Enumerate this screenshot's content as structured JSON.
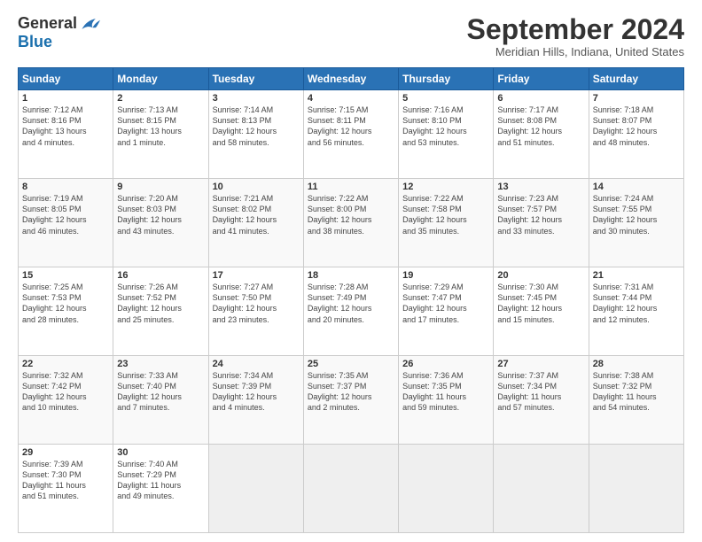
{
  "header": {
    "logo_general": "General",
    "logo_blue": "Blue",
    "title": "September 2024",
    "location": "Meridian Hills, Indiana, United States"
  },
  "days_of_week": [
    "Sunday",
    "Monday",
    "Tuesday",
    "Wednesday",
    "Thursday",
    "Friday",
    "Saturday"
  ],
  "weeks": [
    [
      {
        "day": "1",
        "info": "Sunrise: 7:12 AM\nSunset: 8:16 PM\nDaylight: 13 hours\nand 4 minutes."
      },
      {
        "day": "2",
        "info": "Sunrise: 7:13 AM\nSunset: 8:15 PM\nDaylight: 13 hours\nand 1 minute."
      },
      {
        "day": "3",
        "info": "Sunrise: 7:14 AM\nSunset: 8:13 PM\nDaylight: 12 hours\nand 58 minutes."
      },
      {
        "day": "4",
        "info": "Sunrise: 7:15 AM\nSunset: 8:11 PM\nDaylight: 12 hours\nand 56 minutes."
      },
      {
        "day": "5",
        "info": "Sunrise: 7:16 AM\nSunset: 8:10 PM\nDaylight: 12 hours\nand 53 minutes."
      },
      {
        "day": "6",
        "info": "Sunrise: 7:17 AM\nSunset: 8:08 PM\nDaylight: 12 hours\nand 51 minutes."
      },
      {
        "day": "7",
        "info": "Sunrise: 7:18 AM\nSunset: 8:07 PM\nDaylight: 12 hours\nand 48 minutes."
      }
    ],
    [
      {
        "day": "8",
        "info": "Sunrise: 7:19 AM\nSunset: 8:05 PM\nDaylight: 12 hours\nand 46 minutes."
      },
      {
        "day": "9",
        "info": "Sunrise: 7:20 AM\nSunset: 8:03 PM\nDaylight: 12 hours\nand 43 minutes."
      },
      {
        "day": "10",
        "info": "Sunrise: 7:21 AM\nSunset: 8:02 PM\nDaylight: 12 hours\nand 41 minutes."
      },
      {
        "day": "11",
        "info": "Sunrise: 7:22 AM\nSunset: 8:00 PM\nDaylight: 12 hours\nand 38 minutes."
      },
      {
        "day": "12",
        "info": "Sunrise: 7:22 AM\nSunset: 7:58 PM\nDaylight: 12 hours\nand 35 minutes."
      },
      {
        "day": "13",
        "info": "Sunrise: 7:23 AM\nSunset: 7:57 PM\nDaylight: 12 hours\nand 33 minutes."
      },
      {
        "day": "14",
        "info": "Sunrise: 7:24 AM\nSunset: 7:55 PM\nDaylight: 12 hours\nand 30 minutes."
      }
    ],
    [
      {
        "day": "15",
        "info": "Sunrise: 7:25 AM\nSunset: 7:53 PM\nDaylight: 12 hours\nand 28 minutes."
      },
      {
        "day": "16",
        "info": "Sunrise: 7:26 AM\nSunset: 7:52 PM\nDaylight: 12 hours\nand 25 minutes."
      },
      {
        "day": "17",
        "info": "Sunrise: 7:27 AM\nSunset: 7:50 PM\nDaylight: 12 hours\nand 23 minutes."
      },
      {
        "day": "18",
        "info": "Sunrise: 7:28 AM\nSunset: 7:49 PM\nDaylight: 12 hours\nand 20 minutes."
      },
      {
        "day": "19",
        "info": "Sunrise: 7:29 AM\nSunset: 7:47 PM\nDaylight: 12 hours\nand 17 minutes."
      },
      {
        "day": "20",
        "info": "Sunrise: 7:30 AM\nSunset: 7:45 PM\nDaylight: 12 hours\nand 15 minutes."
      },
      {
        "day": "21",
        "info": "Sunrise: 7:31 AM\nSunset: 7:44 PM\nDaylight: 12 hours\nand 12 minutes."
      }
    ],
    [
      {
        "day": "22",
        "info": "Sunrise: 7:32 AM\nSunset: 7:42 PM\nDaylight: 12 hours\nand 10 minutes."
      },
      {
        "day": "23",
        "info": "Sunrise: 7:33 AM\nSunset: 7:40 PM\nDaylight: 12 hours\nand 7 minutes."
      },
      {
        "day": "24",
        "info": "Sunrise: 7:34 AM\nSunset: 7:39 PM\nDaylight: 12 hours\nand 4 minutes."
      },
      {
        "day": "25",
        "info": "Sunrise: 7:35 AM\nSunset: 7:37 PM\nDaylight: 12 hours\nand 2 minutes."
      },
      {
        "day": "26",
        "info": "Sunrise: 7:36 AM\nSunset: 7:35 PM\nDaylight: 11 hours\nand 59 minutes."
      },
      {
        "day": "27",
        "info": "Sunrise: 7:37 AM\nSunset: 7:34 PM\nDaylight: 11 hours\nand 57 minutes."
      },
      {
        "day": "28",
        "info": "Sunrise: 7:38 AM\nSunset: 7:32 PM\nDaylight: 11 hours\nand 54 minutes."
      }
    ],
    [
      {
        "day": "29",
        "info": "Sunrise: 7:39 AM\nSunset: 7:30 PM\nDaylight: 11 hours\nand 51 minutes."
      },
      {
        "day": "30",
        "info": "Sunrise: 7:40 AM\nSunset: 7:29 PM\nDaylight: 11 hours\nand 49 minutes."
      },
      {
        "day": "",
        "info": ""
      },
      {
        "day": "",
        "info": ""
      },
      {
        "day": "",
        "info": ""
      },
      {
        "day": "",
        "info": ""
      },
      {
        "day": "",
        "info": ""
      }
    ]
  ]
}
